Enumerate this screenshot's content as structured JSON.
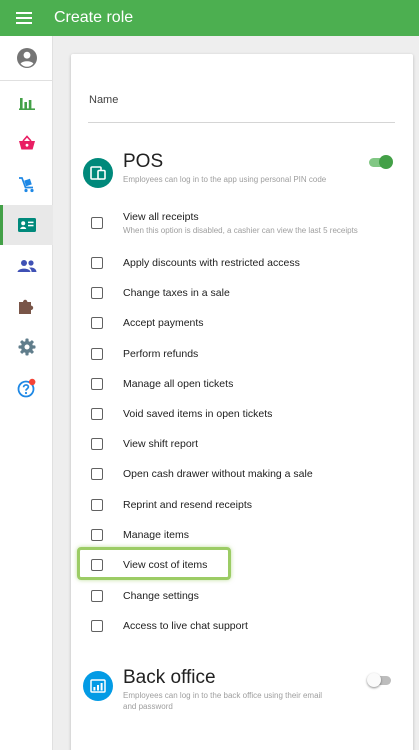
{
  "header": {
    "title": "Create role",
    "menu_icon": "hamburger-icon"
  },
  "colors": {
    "brand_green": "#4caf50",
    "pos_icon": "#00897b",
    "back_office_icon": "#039be5",
    "highlight": "#9ccc65"
  },
  "sidebar": {
    "items": [
      {
        "name": "account",
        "icon": "account-circle-icon"
      },
      {
        "name": "reports",
        "icon": "bar-chart-icon"
      },
      {
        "name": "sales",
        "icon": "basket-icon"
      },
      {
        "name": "inventory",
        "icon": "cart-icon"
      },
      {
        "name": "employees",
        "icon": "badge-icon",
        "active": true
      },
      {
        "name": "customers",
        "icon": "people-icon"
      },
      {
        "name": "integrations",
        "icon": "puzzle-icon"
      },
      {
        "name": "settings",
        "icon": "gear-icon"
      },
      {
        "name": "help",
        "icon": "help-icon",
        "has_notification": true
      }
    ]
  },
  "form": {
    "name_label": "Name",
    "name_value": ""
  },
  "pos": {
    "title": "POS",
    "description": "Employees can log in to the app using personal PIN code",
    "enabled": true,
    "permissions": [
      {
        "label": "View all receipts",
        "sub": "When this option is disabled, a cashier can view the last 5 receipts",
        "checked": false
      },
      {
        "label": "Apply discounts with restricted access",
        "checked": false
      },
      {
        "label": "Change taxes in a sale",
        "checked": false
      },
      {
        "label": "Accept payments",
        "checked": false
      },
      {
        "label": "Perform refunds",
        "checked": false
      },
      {
        "label": "Manage all open tickets",
        "checked": false
      },
      {
        "label": "Void saved items in open tickets",
        "checked": false
      },
      {
        "label": "View shift report",
        "checked": false
      },
      {
        "label": "Open cash drawer without making a sale",
        "checked": false
      },
      {
        "label": "Reprint and resend receipts",
        "checked": false
      },
      {
        "label": "Manage items",
        "checked": false
      },
      {
        "label": "View cost of items",
        "checked": false,
        "highlighted": true
      },
      {
        "label": "Change settings",
        "checked": false
      },
      {
        "label": "Access to live chat support",
        "checked": false
      }
    ]
  },
  "back_office": {
    "title": "Back office",
    "description": "Employees can log in to the back office using their email and password",
    "enabled": false
  }
}
